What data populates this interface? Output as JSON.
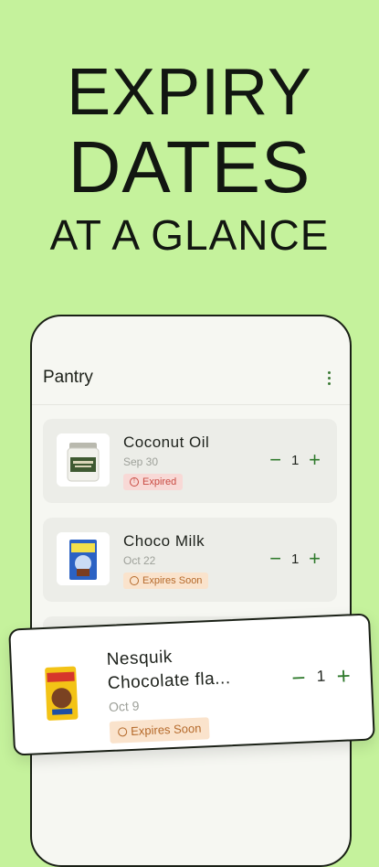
{
  "headline": {
    "line1": "EXPIRY",
    "line2": "DATES",
    "line3": "AT A GLANCE"
  },
  "app": {
    "title": "Pantry",
    "menu_icon": "kebab-menu-icon",
    "accent": "#2f7a2c"
  },
  "items": [
    {
      "name": "Coconut Oil",
      "date": "Sep 30",
      "status": "Expired",
      "quantity": "1",
      "minus": "−",
      "plus": "+"
    },
    {
      "name": "Choco Milk",
      "date": "Oct 22",
      "status": "Expires Soon",
      "quantity": "1",
      "minus": "−",
      "plus": "+"
    }
  ],
  "featured": {
    "name_line1": "Nesquik",
    "name_line2": "Chocolate fla...",
    "date": "Oct 9",
    "status": "Expires Soon",
    "quantity": "1",
    "minus": "−",
    "plus": "+"
  },
  "colors": {
    "background": "#c5f29c",
    "expired_badge": "#f8d9d6",
    "expired_text": "#c84a42",
    "soon_badge": "#fae3cc",
    "soon_text": "#b56a2b"
  }
}
